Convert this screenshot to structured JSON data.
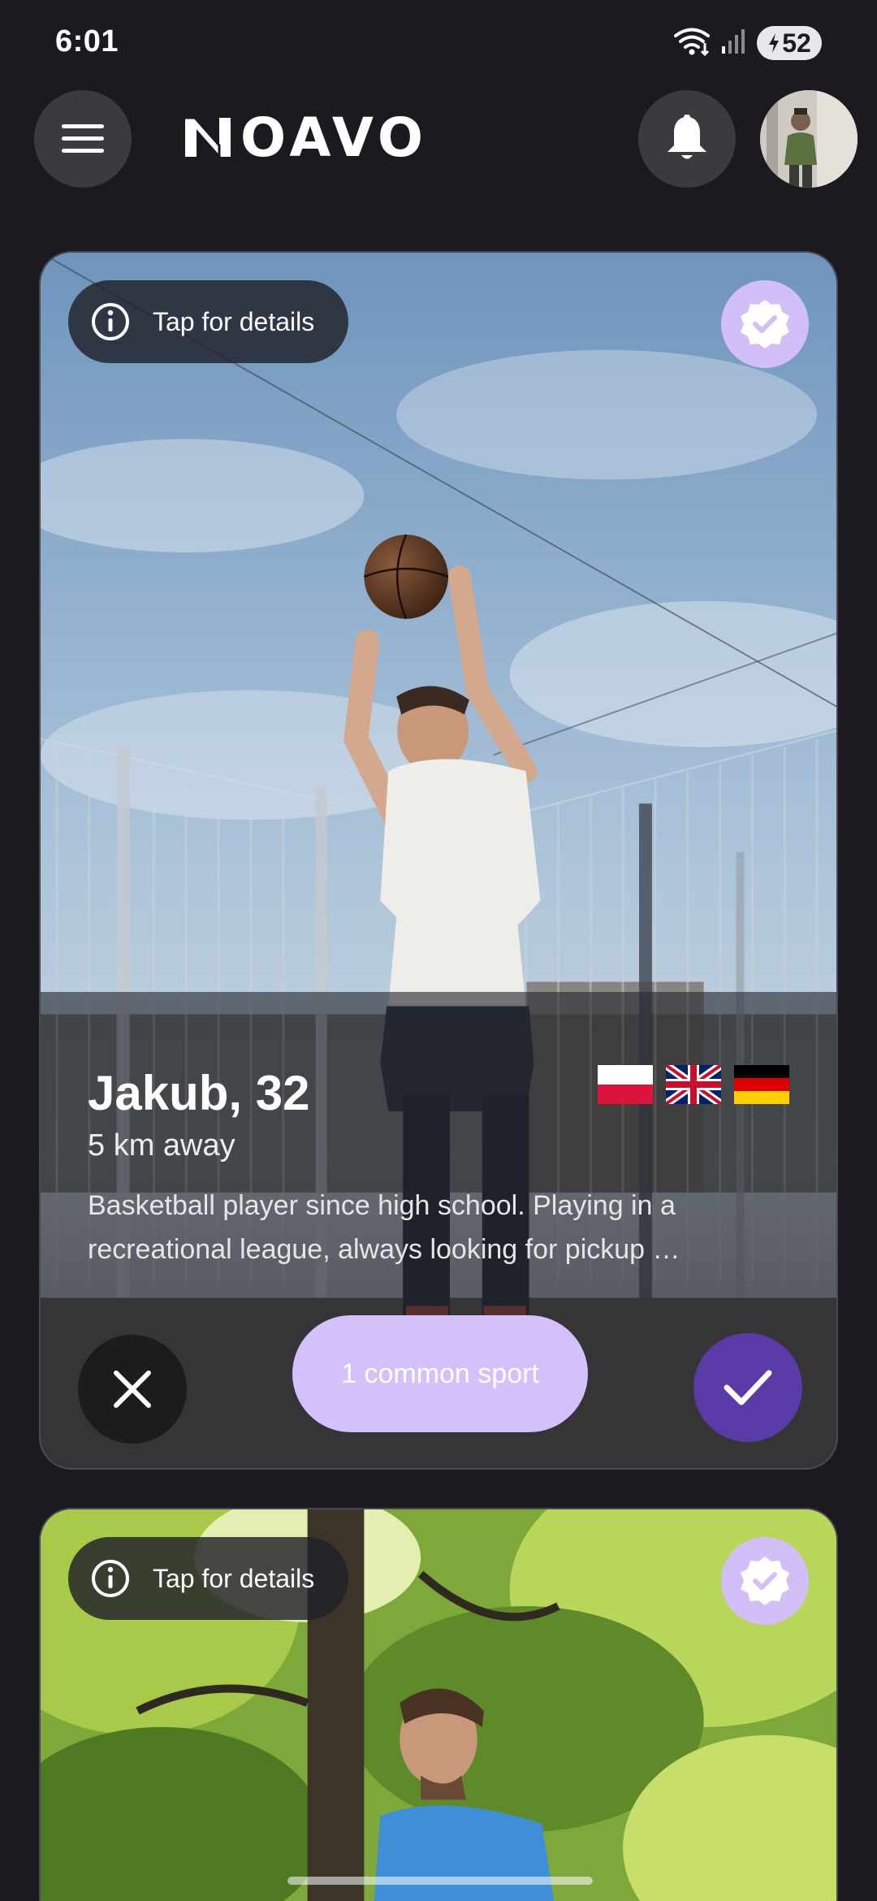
{
  "status_bar": {
    "time": "6:01",
    "battery_level": "52",
    "icons": [
      "wifi-icon",
      "signal-icon",
      "battery-icon"
    ]
  },
  "header": {
    "logo_text": "OAVO",
    "logo_mark": "N",
    "icons": [
      "menu-icon",
      "bell-icon",
      "avatar"
    ]
  },
  "cards": [
    {
      "details_label": "Tap for details",
      "verified": true,
      "name_age": "Jakub, 32",
      "distance": "5 km away",
      "bio": "Basketball player since high school. Playing in a recreational league, always looking for pickup …",
      "languages": [
        "Polish",
        "English",
        "German"
      ],
      "common_sports": "1 common sport"
    },
    {
      "details_label": "Tap for details",
      "verified": true
    }
  ],
  "colors": {
    "background": "#1c1a20",
    "accent_light": "#d4c0fa",
    "accent_dark": "#5a3aa6",
    "button_dark": "#3c3a41"
  }
}
